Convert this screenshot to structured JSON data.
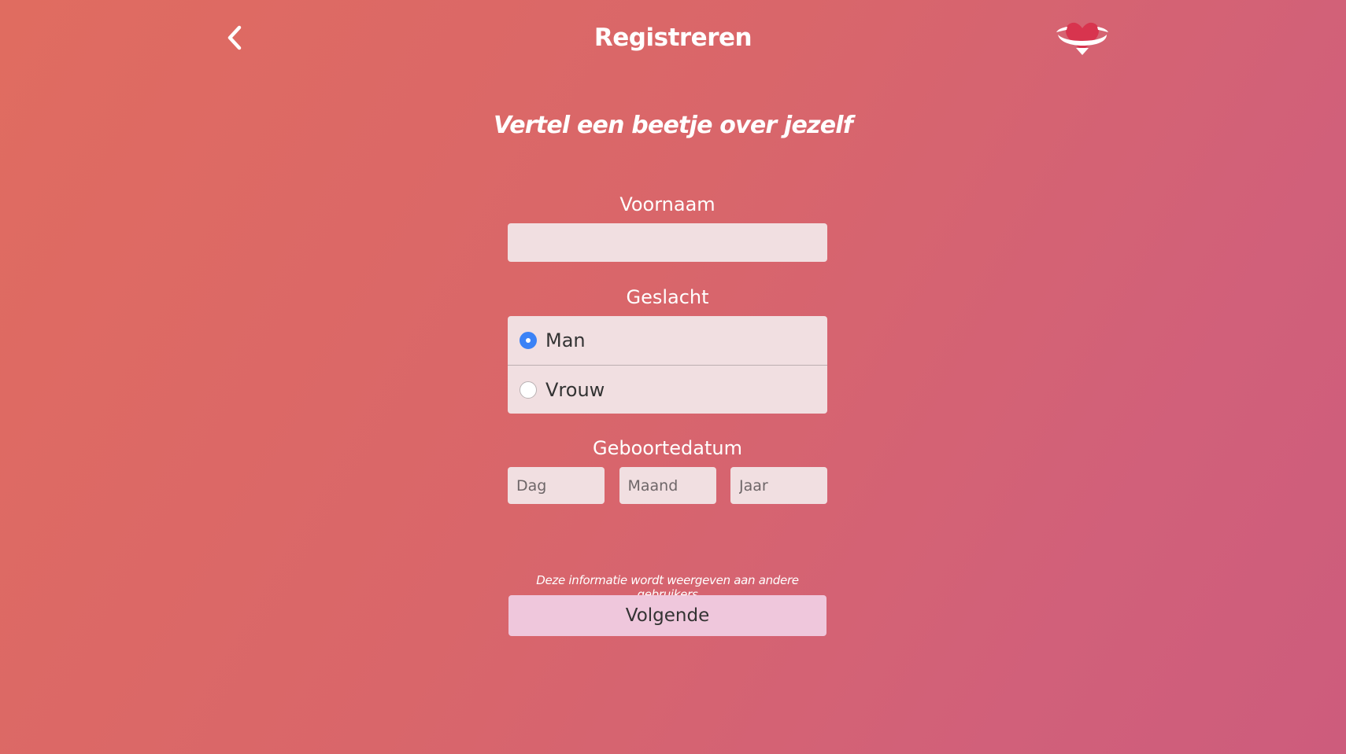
{
  "header": {
    "title": "Registreren",
    "back_icon": "chevron-left-icon",
    "logo_icon": "heart-logo-icon"
  },
  "subtitle": "Vertel een beetje over jezelf",
  "form": {
    "voornaam": {
      "label": "Voornaam",
      "value": "",
      "placeholder": ""
    },
    "geslacht": {
      "label": "Geslacht",
      "options": [
        {
          "label": "Man",
          "checked": true
        },
        {
          "label": "Vrouw",
          "checked": false
        }
      ]
    },
    "geboortedatum": {
      "label": "Geboortedatum",
      "dag_placeholder": "Dag",
      "maand_placeholder": "Maand",
      "jaar_placeholder": "Jaar"
    }
  },
  "info_note": "Deze informatie wordt weergeven aan andere gebruikers",
  "next_button": "Volgende",
  "colors": {
    "background_start": "#e06c60",
    "background_end": "#cd5c7c",
    "input_bg": "#f1dfe1",
    "button_bg": "#efc7dc",
    "radio_accent": "#3b82f6",
    "logo_heart": "#d8344e"
  }
}
